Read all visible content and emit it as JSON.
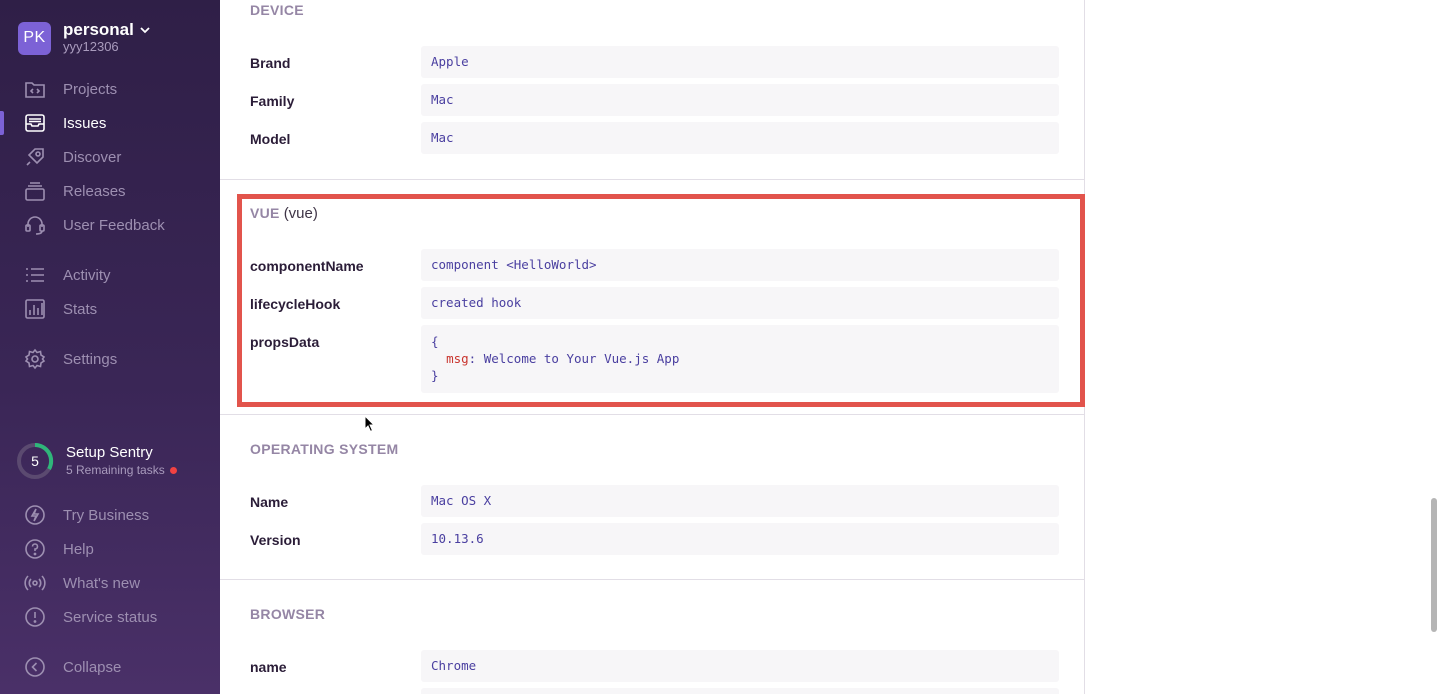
{
  "sidebar": {
    "org": {
      "initials": "PK",
      "name": "personal",
      "user": "yyy12306"
    },
    "nav_main": [
      {
        "label": "Projects",
        "icon": "projects-icon"
      },
      {
        "label": "Issues",
        "icon": "issues-icon"
      },
      {
        "label": "Discover",
        "icon": "discover-icon"
      },
      {
        "label": "Releases",
        "icon": "releases-icon"
      },
      {
        "label": "User Feedback",
        "icon": "user-feedback-icon"
      },
      {
        "label": "Activity",
        "icon": "activity-icon"
      },
      {
        "label": "Stats",
        "icon": "stats-icon"
      },
      {
        "label": "Settings",
        "icon": "settings-icon"
      }
    ],
    "active_item": "Issues",
    "setup": {
      "count": "5",
      "title": "Setup Sentry",
      "subtitle": "5 Remaining tasks"
    },
    "nav_bottom": [
      {
        "label": "Try Business",
        "icon": "lightning-icon"
      },
      {
        "label": "Help",
        "icon": "help-icon"
      },
      {
        "label": "What's new",
        "icon": "broadcast-icon"
      },
      {
        "label": "Service status",
        "icon": "warning-icon"
      },
      {
        "label": "Collapse",
        "icon": "collapse-icon"
      }
    ]
  },
  "device": {
    "title": "DEVICE",
    "rows": [
      {
        "key": "Brand",
        "value": "Apple"
      },
      {
        "key": "Family",
        "value": "Mac"
      },
      {
        "key": "Model",
        "value": "Mac"
      }
    ]
  },
  "vue": {
    "title": "VUE",
    "alias": "(vue)",
    "rows": [
      {
        "key": "componentName",
        "value": "component <HelloWorld>"
      },
      {
        "key": "lifecycleHook",
        "value": "created hook"
      },
      {
        "key": "propsData",
        "open": "{",
        "prop_key": "msg",
        "prop_value": ": Welcome to Your Vue.js App",
        "close": "}"
      }
    ]
  },
  "os": {
    "title": "OPERATING SYSTEM",
    "rows": [
      {
        "key": "Name",
        "value": "Mac OS X"
      },
      {
        "key": "Version",
        "value": "10.13.6"
      }
    ]
  },
  "browser": {
    "title": "BROWSER",
    "rows": [
      {
        "key": "name",
        "value": "Chrome"
      }
    ]
  },
  "colors": {
    "accent": "#7c62d6",
    "highlight": "#e2544c",
    "sidebar": "#2f1f47"
  }
}
